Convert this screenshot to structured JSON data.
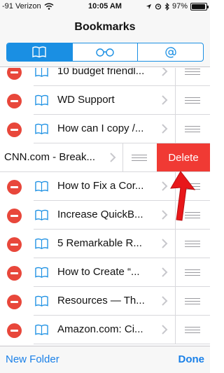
{
  "status": {
    "carrier": "-91 Verizon",
    "time": "10:05 AM",
    "battery": "97%",
    "battery_level": 0.97
  },
  "header": {
    "title": "Bookmarks"
  },
  "segments": [
    {
      "icon": "book-icon",
      "selected": true
    },
    {
      "icon": "reading-list-glasses-icon",
      "selected": false
    },
    {
      "icon": "at-symbol-icon",
      "selected": false
    }
  ],
  "rows": [
    {
      "label": "10 budget friendl..."
    },
    {
      "label": "WD Support"
    },
    {
      "label": "How can I copy /..."
    },
    {
      "label": "CNN.com - Break...",
      "swiped": true
    },
    {
      "label": "How to Fix a Cor..."
    },
    {
      "label": "Increase QuickB..."
    },
    {
      "label": "5 Remarkable R..."
    },
    {
      "label": "How to Create “..."
    },
    {
      "label": "Resources — Th..."
    },
    {
      "label": "Amazon.com: Ci..."
    }
  ],
  "delete_label": "Delete",
  "toolbar": {
    "new_folder": "New Folder",
    "done": "Done"
  },
  "colors": {
    "accent": "#1a8fe3",
    "delete_red": "#f03a34",
    "minus_red": "#e8473b"
  }
}
